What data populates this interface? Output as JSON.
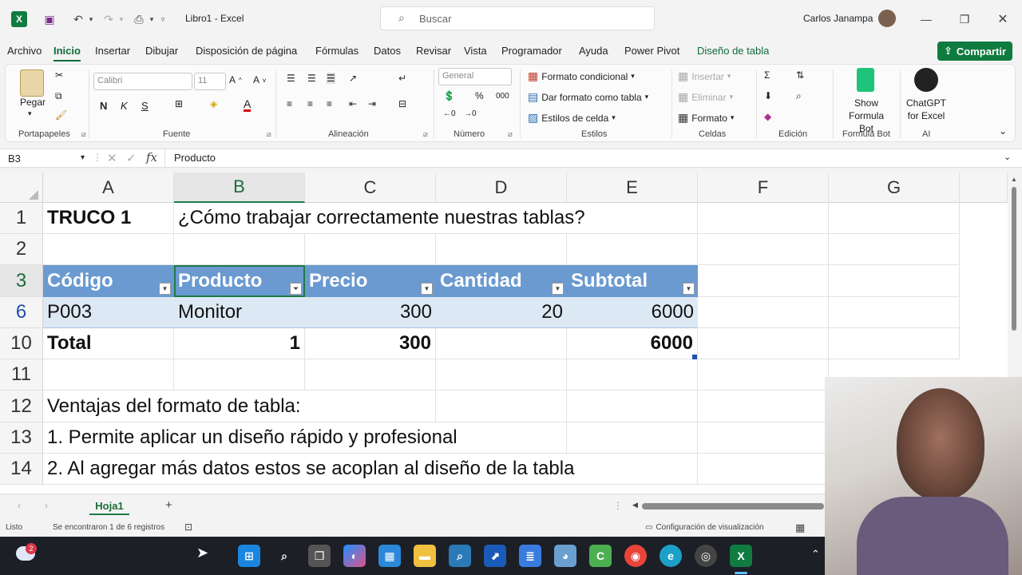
{
  "title_bar": {
    "doc_title": "Libro1  -  Excel",
    "search_placeholder": "Buscar",
    "user_name": "Carlos Janampa"
  },
  "menu": {
    "tabs": [
      "Archivo",
      "Inicio",
      "Insertar",
      "Dibujar",
      "Disposición de página",
      "Fórmulas",
      "Datos",
      "Revisar",
      "Vista",
      "Programador",
      "Ayuda",
      "Power Pivot",
      "Diseño de tabla"
    ],
    "active": "Inicio",
    "share_label": "Compartir"
  },
  "ribbon": {
    "clipboard": {
      "paste": "Pegar",
      "group": "Portapapeles"
    },
    "font": {
      "name": "Calibri",
      "size": "11",
      "bold": "N",
      "italic": "K",
      "underline": "S",
      "group": "Fuente"
    },
    "alignment": {
      "group": "Alineación"
    },
    "number": {
      "format": "General",
      "group": "Número"
    },
    "styles": {
      "conditional": "Formato condicional",
      "as_table": "Dar formato como tabla",
      "cell_styles": "Estilos de celda",
      "group": "Estilos"
    },
    "cells": {
      "insert": "Insertar",
      "delete": "Eliminar",
      "format": "Formato",
      "group": "Celdas"
    },
    "editing": {
      "group": "Edición"
    },
    "formula_bot": {
      "line1": "Show",
      "line2": "Formula Bot",
      "group": "Formula Bot"
    },
    "chatgpt": {
      "line1": "ChatGPT",
      "line2": "for Excel",
      "group": "AI"
    }
  },
  "formula_bar": {
    "name_box": "B3",
    "fx": "fx",
    "content": "Producto"
  },
  "sheet": {
    "columns": [
      "A",
      "B",
      "C",
      "D",
      "E",
      "F",
      "G"
    ],
    "selected_column": "B",
    "rows": [
      {
        "num": "1",
        "A": "TRUCO 1",
        "B": "¿Cómo trabajar correctamente nuestras tablas?"
      },
      {
        "num": "2"
      },
      {
        "num": "3",
        "A": "Código",
        "B": "Producto",
        "C": "Precio",
        "D": "Cantidad",
        "E": "Subtotal"
      },
      {
        "num": "6",
        "A": "P003",
        "B": "Monitor",
        "C": "300",
        "D": "20",
        "E": "6000"
      },
      {
        "num": "10",
        "A": "Total",
        "B": "1",
        "C": "300",
        "E": "6000"
      },
      {
        "num": "11"
      },
      {
        "num": "12",
        "A": "Ventajas del formato de tabla:"
      },
      {
        "num": "13",
        "A": "1. Permite aplicar un diseño rápido y profesional"
      },
      {
        "num": "14",
        "A": "2. Al agregar más datos estos se acoplan al diseño de la tabla"
      }
    ],
    "table_header_color": "#6a9ad0",
    "table_row_color": "#dde8f5"
  },
  "sheet_tabs": {
    "tabs": [
      "Hoja1"
    ],
    "add": "+"
  },
  "status": {
    "mode": "Listo",
    "filter_info": "Se encontraron 1 de 6 registros",
    "display_settings": "Configuración de visualización"
  },
  "taskbar": {
    "notification_count": "2"
  },
  "colors": {
    "excel_green": "#0f7b3f",
    "accent": "#1e6b3a"
  }
}
